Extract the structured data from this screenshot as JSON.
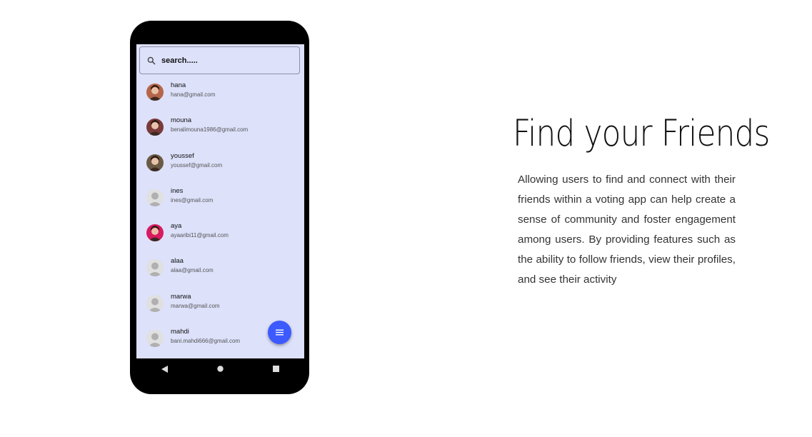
{
  "search": {
    "placeholder": "search....."
  },
  "contacts": [
    {
      "name": "hana",
      "email": "hana@gmail.com",
      "avatar": "photo",
      "color": "#b5654a"
    },
    {
      "name": "mouna",
      "email": "benalimouna1986@gmail.com",
      "avatar": "photo",
      "color": "#7a3a3a"
    },
    {
      "name": "youssef",
      "email": "youssef@gmail.com",
      "avatar": "photo",
      "color": "#6b5a45"
    },
    {
      "name": "ines",
      "email": "ines@gmail.com",
      "avatar": "default-person-icon",
      "color": "#b0b0b0"
    },
    {
      "name": "aya",
      "email": "ayaaribi11@gmail.com",
      "avatar": "photo",
      "color": "#d81b60"
    },
    {
      "name": "alaa",
      "email": "alaa@gmail.com",
      "avatar": "default-person-icon",
      "color": "#b0b0b0"
    },
    {
      "name": "marwa",
      "email": "marwa@gmail.com",
      "avatar": "default-person-icon",
      "color": "#b0b0b0"
    },
    {
      "name": "mahdi",
      "email": "bani.mahdi666@gmail.com",
      "avatar": "default-person-icon",
      "color": "#b0b0b0"
    }
  ],
  "fab": {
    "icon": "menu-icon",
    "color": "#3d5afe"
  },
  "navbar": {
    "icons": [
      "back-icon",
      "home-icon",
      "recents-icon"
    ]
  },
  "promo": {
    "title": "Find your Friends",
    "description": "Allowing users to find and connect with their friends within a voting app can help create a sense of community and foster engagement among users. By providing features such as the ability to follow friends, view their profiles, and see their activity"
  },
  "colors": {
    "screen_bg": "#dde1fa",
    "accent": "#3d5afe"
  }
}
